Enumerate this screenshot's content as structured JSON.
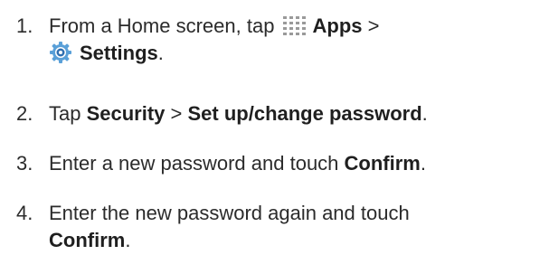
{
  "steps": [
    {
      "number": "1.",
      "prefix": "From a Home screen, tap ",
      "apps_label": "Apps",
      "separator": " >",
      "settings_label": "Settings",
      "suffix": ".",
      "icons": [
        "apps-grid-icon",
        "settings-gear-icon"
      ]
    },
    {
      "number": "2.",
      "prefix": "Tap ",
      "security_label": "Security",
      "separator": " > ",
      "setup_label": "Set up/change password",
      "suffix": "."
    },
    {
      "number": "3.",
      "prefix": "Enter a new password and touch ",
      "confirm_label": "Confirm",
      "suffix": "."
    },
    {
      "number": "4.",
      "prefix": "Enter the new password again and touch",
      "confirm_label": "Confirm",
      "suffix": "."
    }
  ],
  "colors": {
    "text": "#2b2b2b",
    "apps_icon": "#9a9a9a",
    "settings_icon_outer": "#5aa0d8",
    "settings_icon_inner": "#2f6fb0"
  }
}
